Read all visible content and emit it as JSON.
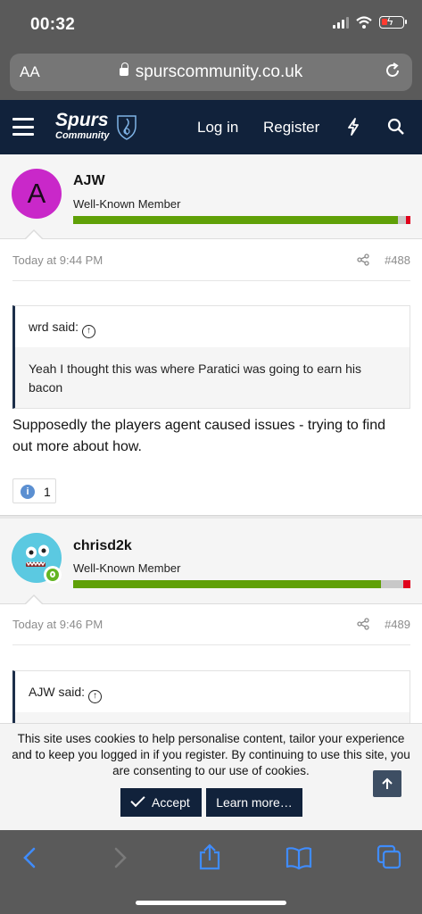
{
  "status_bar": {
    "time": "00:32"
  },
  "browser": {
    "text_size_label": "AA",
    "url": "spurscommunity.co.uk"
  },
  "site": {
    "logo_main": "Spurs",
    "logo_sub": "Community",
    "nav": {
      "login": "Log in",
      "register": "Register"
    }
  },
  "posts": [
    {
      "avatar_letter": "A",
      "username": "AJW",
      "user_title": "Well-Known Member",
      "time": "Today at 9:44 PM",
      "number": "#488",
      "quote": {
        "author": "wrd said:",
        "text": "Yeah I thought this was where Paratici was going to earn his bacon"
      },
      "body": "Supposedly the players agent caused issues - trying to find out more about how.",
      "reaction_count": "1"
    },
    {
      "username": "chrisd2k",
      "user_title": "Well-Known Member",
      "time": "Today at 9:46 PM",
      "number": "#489",
      "quote": {
        "author": "AJW said:"
      }
    }
  ],
  "cookie_notice": {
    "text": "This site uses cookies to help personalise content, tailor your experience and to keep you logged in if you register. By continuing to use this site, you are consenting to our use of cookies.",
    "accept_label": "Accept",
    "learn_more_label": "Learn more…"
  },
  "colors": {
    "header_bg": "#11223b",
    "rep_green": "#5fa007",
    "rep_red": "#e0001b",
    "avatar_a": "#c928c9"
  }
}
